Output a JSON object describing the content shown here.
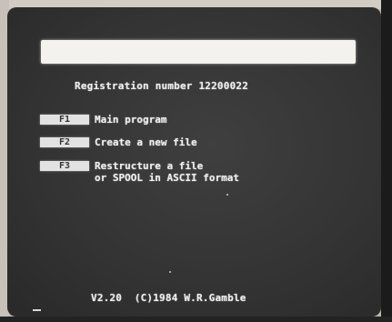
{
  "screen": {
    "registration_text": "Registration number 12200022",
    "menu": [
      {
        "key_label": "F1",
        "label": "Main program"
      },
      {
        "key_label": "F2",
        "label": "Create a new file"
      },
      {
        "key_label": "F3",
        "label": "Restructure a file\nor SPOOL in ASCII format"
      }
    ],
    "version_text": "V2.20  (C)1984 W.R.Gamble",
    "colors": {
      "screen_background": "#343434",
      "text": "#eeeeee",
      "title_bar": "#f4f2ee",
      "key_highlight": "#e2e2e2"
    },
    "icons": [
      "text-cursor-icon"
    ]
  }
}
